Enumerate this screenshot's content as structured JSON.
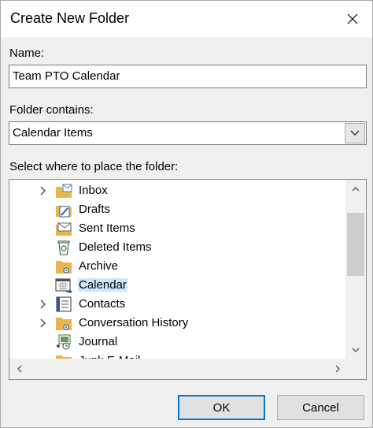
{
  "dialog": {
    "title": "Create New Folder",
    "name_label": "Name:",
    "name_value": "Team PTO Calendar",
    "contains_label": "Folder contains:",
    "contains_value": "Calendar Items",
    "place_label": "Select where to place the folder:",
    "ok_label": "OK",
    "cancel_label": "Cancel"
  },
  "tree": {
    "items": [
      {
        "label": "Inbox",
        "icon": "inbox-folder-icon",
        "expandable": true,
        "selected": false
      },
      {
        "label": "Drafts",
        "icon": "drafts-folder-icon",
        "expandable": false,
        "selected": false
      },
      {
        "label": "Sent Items",
        "icon": "sent-items-folder-icon",
        "expandable": false,
        "selected": false
      },
      {
        "label": "Deleted Items",
        "icon": "recycle-bin-icon",
        "expandable": false,
        "selected": false
      },
      {
        "label": "Archive",
        "icon": "archive-folder-icon",
        "expandable": false,
        "selected": false
      },
      {
        "label": "Calendar",
        "icon": "calendar-folder-icon",
        "expandable": false,
        "selected": true
      },
      {
        "label": "Contacts",
        "icon": "contacts-folder-icon",
        "expandable": true,
        "selected": false
      },
      {
        "label": "Conversation History",
        "icon": "conversation-folder-icon",
        "expandable": true,
        "selected": false
      },
      {
        "label": "Journal",
        "icon": "journal-folder-icon",
        "expandable": false,
        "selected": false
      },
      {
        "label": "Junk E-Mail",
        "icon": "junk-folder-icon",
        "expandable": false,
        "selected": false
      }
    ]
  },
  "colors": {
    "selection": "#cce8ff",
    "default_button_border": "#0078d7",
    "folder_yellow": "#e8b64a"
  }
}
